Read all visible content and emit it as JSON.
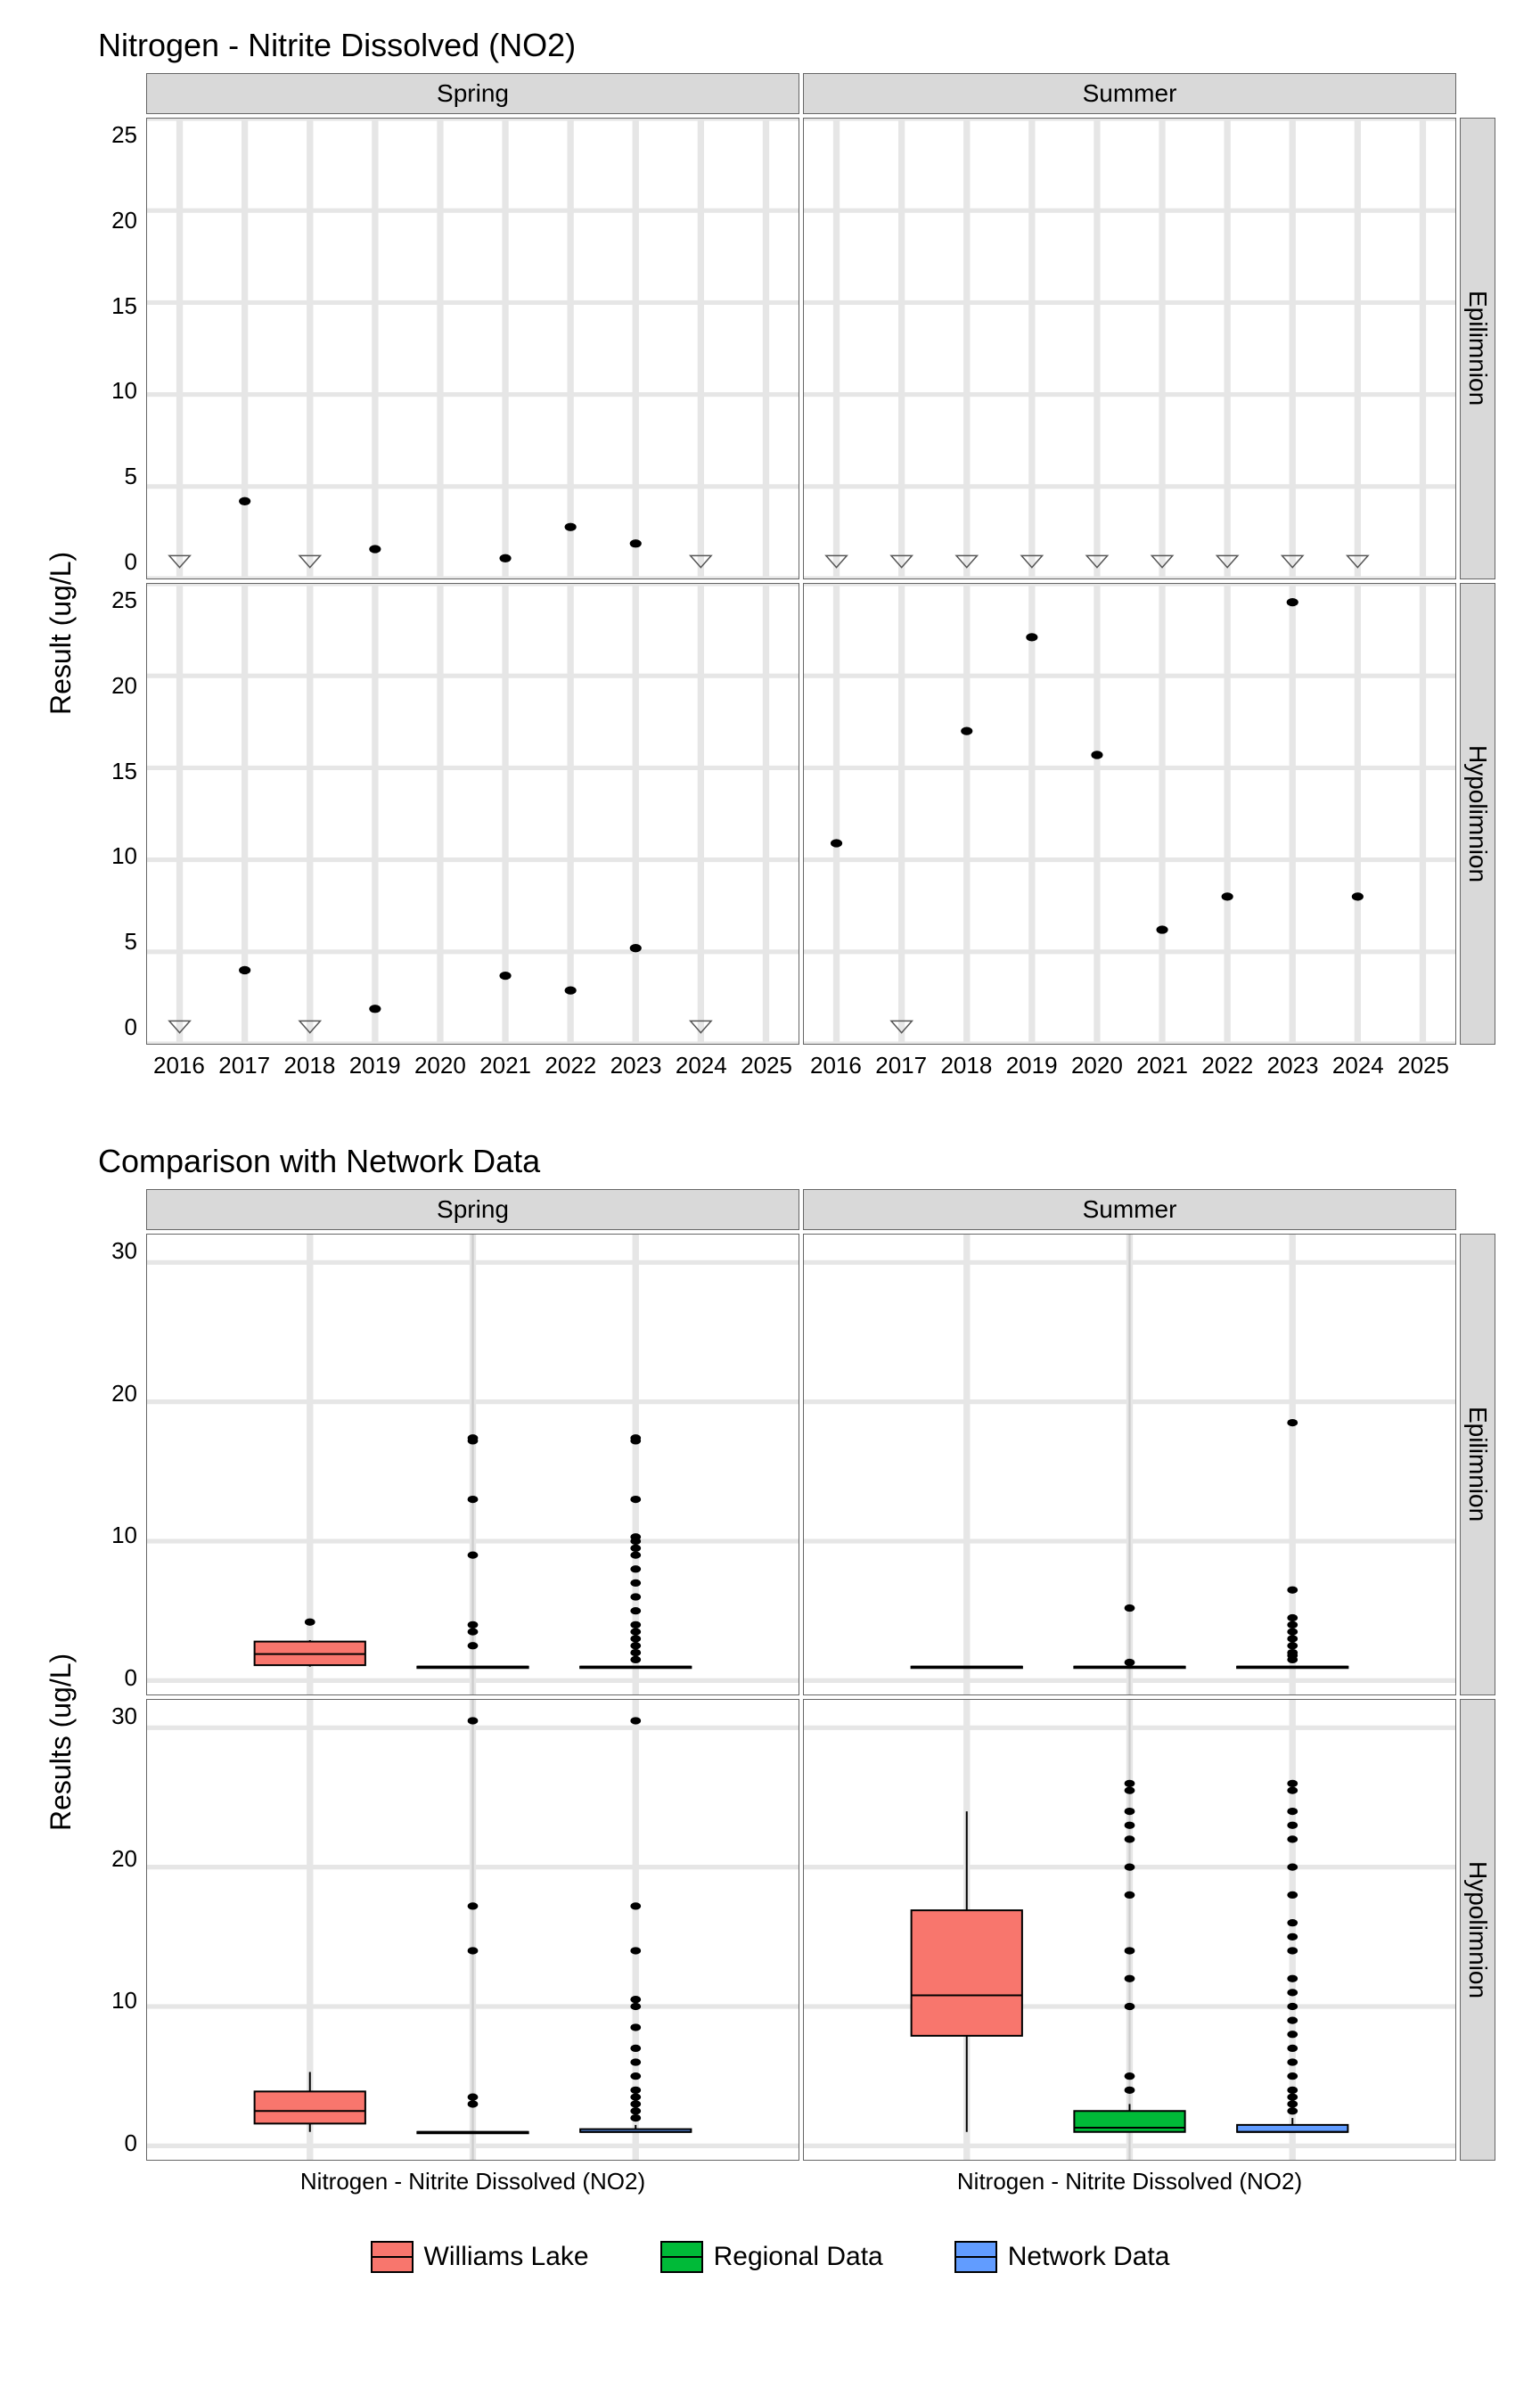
{
  "chart_data": [
    {
      "type": "scatter",
      "title": "Nitrogen - Nitrite Dissolved (NO2)",
      "xlabel": "",
      "ylabel": "Result (ug/L)",
      "x_ticks": [
        "2016",
        "2017",
        "2018",
        "2019",
        "2020",
        "2021",
        "2022",
        "2023",
        "2024",
        "2025"
      ],
      "y_ticks": [
        0,
        5,
        10,
        15,
        20,
        25
      ],
      "col_facets": [
        "Spring",
        "Summer"
      ],
      "row_facets": [
        "Epilimnion",
        "Hypolimnion"
      ],
      "point_shapes": {
        "dot": "detected",
        "triangle": "below-detection"
      },
      "panels": {
        "Spring|Epilimnion": {
          "dots": [
            {
              "x": 2017,
              "y": 4.2
            },
            {
              "x": 2019,
              "y": 1.6
            },
            {
              "x": 2021,
              "y": 1.1
            },
            {
              "x": 2022,
              "y": 2.8
            },
            {
              "x": 2023,
              "y": 1.9
            }
          ],
          "tris": [
            {
              "x": 2016,
              "y": 1
            },
            {
              "x": 2018,
              "y": 1
            },
            {
              "x": 2024,
              "y": 1
            }
          ]
        },
        "Summer|Epilimnion": {
          "dots": [],
          "tris": [
            {
              "x": 2016,
              "y": 1
            },
            {
              "x": 2017,
              "y": 1
            },
            {
              "x": 2018,
              "y": 1
            },
            {
              "x": 2019,
              "y": 1
            },
            {
              "x": 2020,
              "y": 1
            },
            {
              "x": 2021,
              "y": 1
            },
            {
              "x": 2022,
              "y": 1
            },
            {
              "x": 2023,
              "y": 1
            },
            {
              "x": 2024,
              "y": 1
            }
          ]
        },
        "Spring|Hypolimnion": {
          "dots": [
            {
              "x": 2017,
              "y": 4.0
            },
            {
              "x": 2019,
              "y": 1.9
            },
            {
              "x": 2021,
              "y": 3.7
            },
            {
              "x": 2022,
              "y": 2.9
            },
            {
              "x": 2023,
              "y": 5.2
            }
          ],
          "tris": [
            {
              "x": 2016,
              "y": 1
            },
            {
              "x": 2018,
              "y": 1
            },
            {
              "x": 2024,
              "y": 1
            }
          ]
        },
        "Summer|Hypolimnion": {
          "dots": [
            {
              "x": 2016,
              "y": 10.9
            },
            {
              "x": 2018,
              "y": 17.0
            },
            {
              "x": 2019,
              "y": 22.1
            },
            {
              "x": 2020,
              "y": 15.7
            },
            {
              "x": 2021,
              "y": 6.2
            },
            {
              "x": 2022,
              "y": 8.0
            },
            {
              "x": 2023,
              "y": 24.0
            },
            {
              "x": 2024,
              "y": 8.0
            }
          ],
          "tris": [
            {
              "x": 2017,
              "y": 1
            }
          ]
        }
      }
    },
    {
      "type": "boxplot",
      "title": "Comparison with Network Data",
      "xlabel": "",
      "ylabel": "Results (ug/L)",
      "x_category": "Nitrogen - Nitrite Dissolved (NO2)",
      "y_ticks": [
        0,
        10,
        20,
        30
      ],
      "col_facets": [
        "Spring",
        "Summer"
      ],
      "row_facets": [
        "Epilimnion",
        "Hypolimnion"
      ],
      "series": [
        "Williams Lake",
        "Regional Data",
        "Network Data"
      ],
      "colors": {
        "Williams Lake": "#f8766d",
        "Regional Data": "#00ba38",
        "Network Data": "#619cff"
      },
      "panels": {
        "Spring|Epilimnion": {
          "boxes": [
            {
              "series": "Williams Lake",
              "min": 1,
              "q1": 1.1,
              "med": 1.9,
              "q3": 2.8,
              "max": 2.9,
              "outliers": [
                4.2
              ]
            },
            {
              "series": "Regional Data",
              "min": 1,
              "q1": 1,
              "med": 1,
              "q3": 1,
              "max": 1,
              "outliers": [
                2.5,
                3.5,
                4,
                9,
                13,
                17.2,
                17.4
              ]
            },
            {
              "series": "Network Data",
              "min": 1,
              "q1": 1,
              "med": 1,
              "q3": 1,
              "max": 1,
              "outliers": [
                1.5,
                2,
                2.5,
                3,
                3.5,
                4,
                5,
                6,
                7,
                8,
                9,
                9.5,
                10,
                10.3,
                13,
                17.2,
                17.4
              ]
            }
          ]
        },
        "Summer|Epilimnion": {
          "boxes": [
            {
              "series": "Williams Lake",
              "min": 1,
              "q1": 1,
              "med": 1,
              "q3": 1,
              "max": 1,
              "outliers": []
            },
            {
              "series": "Regional Data",
              "min": 1,
              "q1": 1,
              "med": 1,
              "q3": 1,
              "max": 1,
              "outliers": [
                1.3,
                5.2
              ]
            },
            {
              "series": "Network Data",
              "min": 1,
              "q1": 1,
              "med": 1,
              "q3": 1,
              "max": 1,
              "outliers": [
                1.5,
                1.8,
                2,
                2.5,
                3,
                3.5,
                4,
                4.5,
                6.5,
                18.5
              ]
            }
          ]
        },
        "Spring|Hypolimnion": {
          "boxes": [
            {
              "series": "Williams Lake",
              "min": 1,
              "q1": 1.6,
              "med": 2.5,
              "q3": 3.9,
              "max": 5.3,
              "outliers": []
            },
            {
              "series": "Regional Data",
              "min": 1,
              "q1": 1,
              "med": 1,
              "q3": 1,
              "max": 1,
              "outliers": [
                3,
                3.5,
                14,
                17.2,
                30.5
              ]
            },
            {
              "series": "Network Data",
              "min": 1,
              "q1": 1,
              "med": 1,
              "q3": 1.2,
              "max": 1.5,
              "outliers": [
                2,
                2.5,
                3,
                3.5,
                4,
                5,
                6,
                7,
                8.5,
                10,
                10.5,
                14,
                17.2,
                30.5
              ]
            }
          ]
        },
        "Summer|Hypolimnion": {
          "boxes": [
            {
              "series": "Williams Lake",
              "min": 1,
              "q1": 7.9,
              "med": 10.8,
              "q3": 16.9,
              "max": 24,
              "outliers": []
            },
            {
              "series": "Regional Data",
              "min": 1,
              "q1": 1,
              "med": 1.3,
              "q3": 2.5,
              "max": 3,
              "outliers": [
                4,
                5,
                10,
                12,
                14,
                18,
                20,
                22,
                23,
                24,
                25.5,
                26
              ]
            },
            {
              "series": "Network Data",
              "min": 1,
              "q1": 1,
              "med": 1,
              "q3": 1.5,
              "max": 2,
              "outliers": [
                2.5,
                3,
                3.5,
                4,
                5,
                6,
                7,
                8,
                9,
                10,
                11,
                12,
                14,
                15,
                16,
                18,
                20,
                22,
                23,
                24,
                25.5,
                26
              ]
            }
          ]
        }
      }
    }
  ],
  "legend": {
    "items": [
      "Williams Lake",
      "Regional Data",
      "Network Data"
    ]
  }
}
